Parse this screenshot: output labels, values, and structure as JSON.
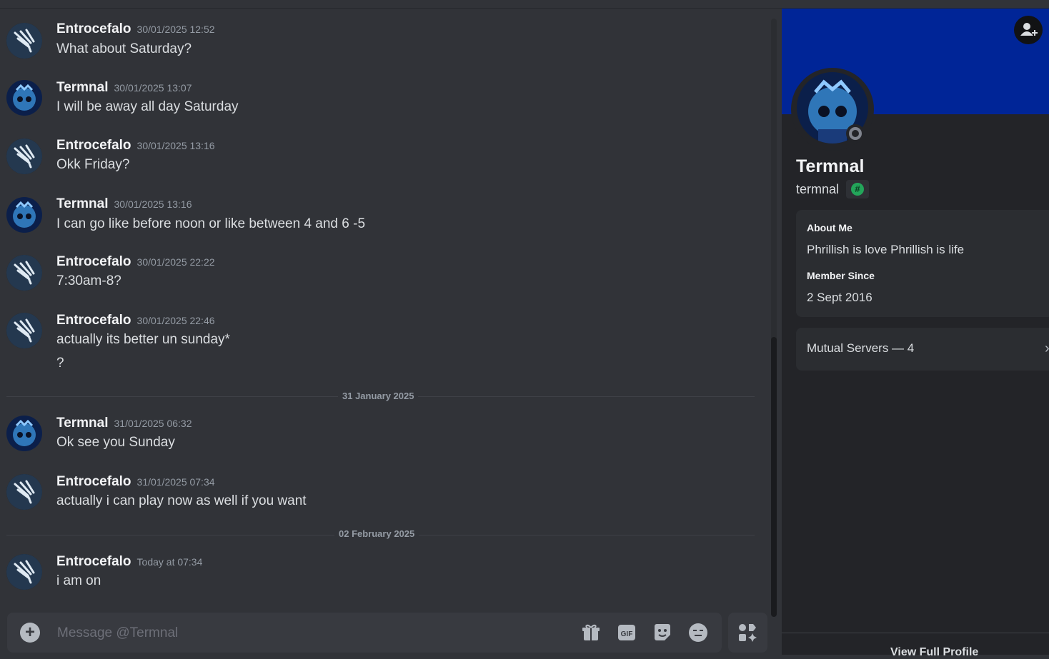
{
  "messages": [
    {
      "author": "Entrocefalo",
      "time": "30/01/2025 12:52",
      "lines": [
        "What about Saturday?"
      ]
    },
    {
      "author": "Termnal",
      "time": "30/01/2025 13:07",
      "lines": [
        "I will be away all day Saturday"
      ]
    },
    {
      "author": "Entrocefalo",
      "time": "30/01/2025 13:16",
      "lines": [
        "Okk Friday?"
      ]
    },
    {
      "author": "Termnal",
      "time": "30/01/2025 13:16",
      "lines": [
        "I can go like before noon or like between 4 and 6 -5"
      ]
    },
    {
      "author": "Entrocefalo",
      "time": "30/01/2025 22:22",
      "lines": [
        "7:30am-8?"
      ]
    },
    {
      "author": "Entrocefalo",
      "time": "30/01/2025 22:46",
      "lines": [
        "actually its better un sunday*",
        "?"
      ]
    },
    {
      "author": "Termnal",
      "time": "31/01/2025 06:32",
      "lines": [
        "Ok see you Sunday"
      ]
    },
    {
      "author": "Entrocefalo",
      "time": "31/01/2025 07:34",
      "lines": [
        "actually i can play now as well if you want"
      ]
    },
    {
      "author": "Entrocefalo",
      "time": "Today at 07:34",
      "lines": [
        "i am on"
      ]
    }
  ],
  "dividers": [
    "31 January 2025",
    "02 February 2025"
  ],
  "composer": {
    "placeholder": "Message @Termnal"
  },
  "profile": {
    "display_name": "Termnal",
    "username": "termnal",
    "badge": "#",
    "banner_color": "#002597",
    "about_heading": "About Me",
    "about_text": "Phrillish is love Phrillish is life",
    "member_heading": "Member Since",
    "member_since": "2 Sept 2016",
    "mutual_servers": "Mutual Servers — 4",
    "view_full": "View Full Profile"
  },
  "icons": {
    "composer": [
      "add-attachment-icon",
      "gift-icon",
      "gif-icon",
      "sticker-icon",
      "emoji-icon"
    ],
    "apps": "apps-icon",
    "add_friend": "add-friend-icon"
  }
}
